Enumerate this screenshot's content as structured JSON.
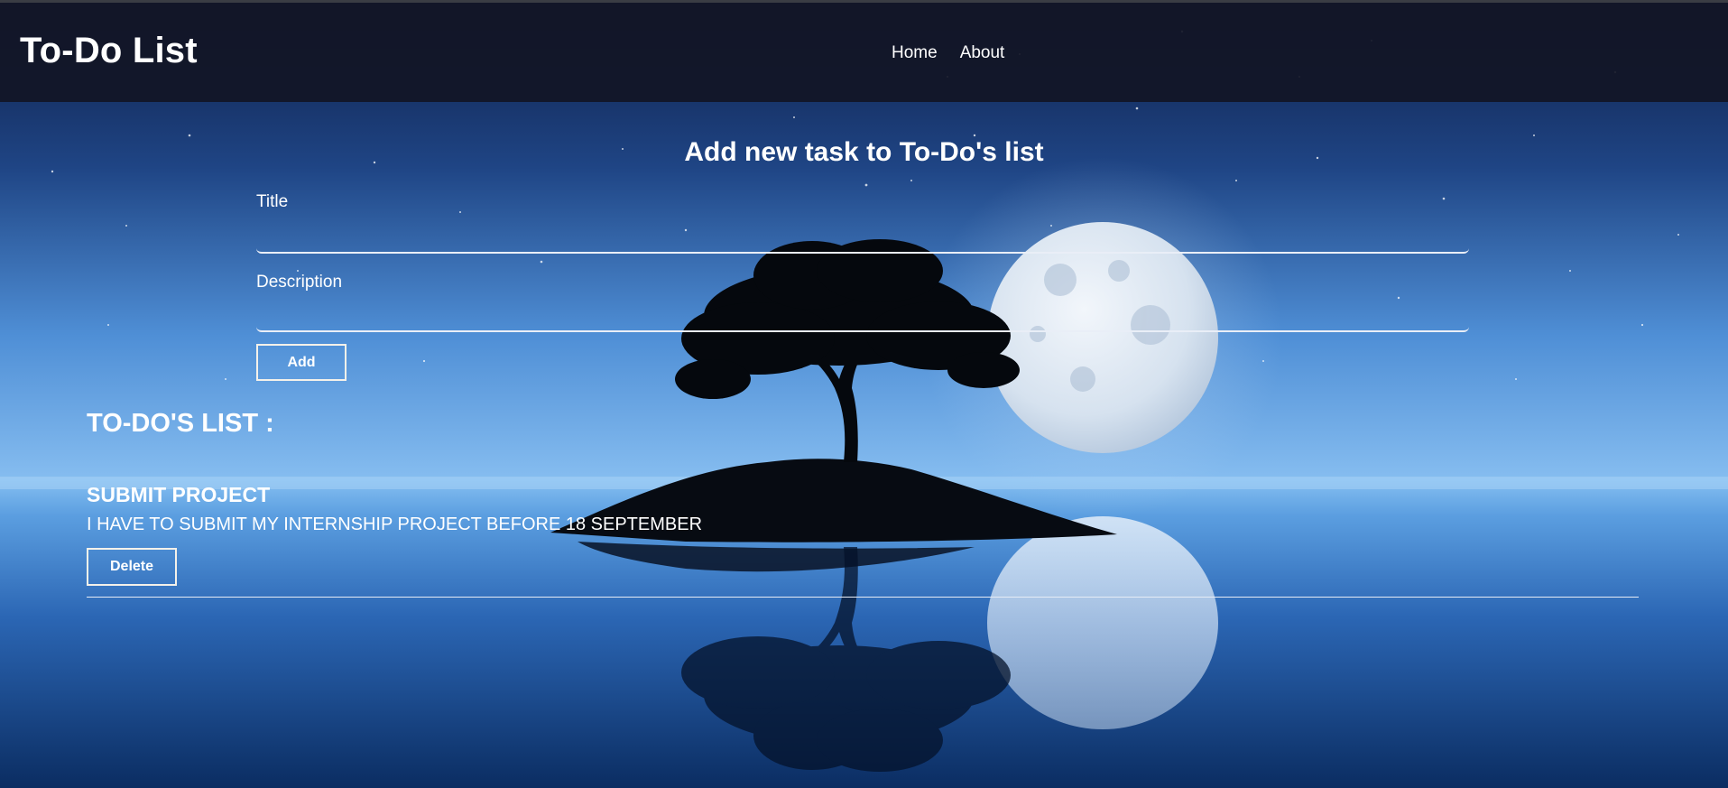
{
  "app": {
    "title": "To-Do List"
  },
  "nav": {
    "items": [
      {
        "label": "Home"
      },
      {
        "label": "About"
      }
    ]
  },
  "form": {
    "heading": "Add new task to To-Do's list",
    "title_label": "Title",
    "title_value": "",
    "description_label": "Description",
    "description_value": "",
    "add_label": "Add"
  },
  "list": {
    "heading": "TO-DO'S LIST :",
    "items": [
      {
        "title": "SUBMIT PROJECT",
        "description": "I HAVE TO SUBMIT MY INTERNSHIP PROJECT BEFORE 18 SEPTEMBER",
        "delete_label": "Delete"
      }
    ]
  },
  "colors": {
    "navbar_bg": "#121626",
    "text": "#ffffff",
    "sky_top": "#0f2250",
    "horizon": "#7fb6ec",
    "sea_bottom": "#0a2a5c"
  }
}
